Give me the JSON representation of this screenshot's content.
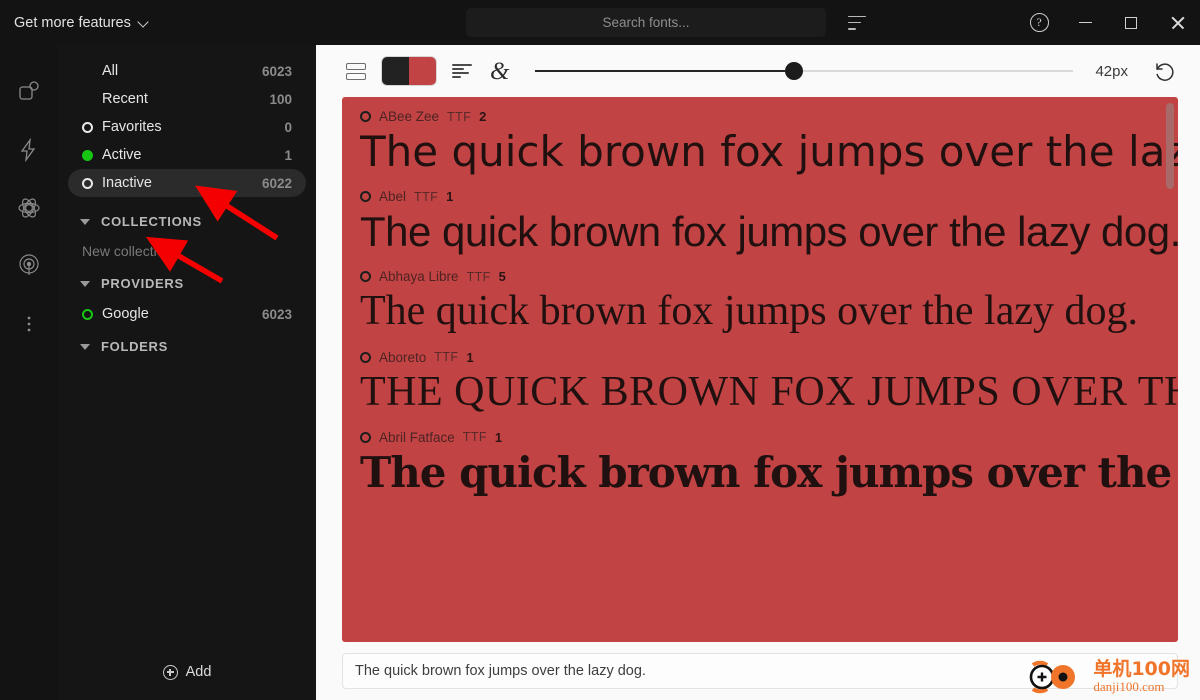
{
  "titlebar": {
    "features_label": "Get more features",
    "chevron_icon": "chevron-down-icon",
    "search_placeholder": "Search fonts...",
    "sort_icon": "sort-icon",
    "help_icon": "help-circle-icon",
    "minimize_icon": "minimize-icon",
    "maximize_icon": "maximize-icon",
    "close_icon": "close-icon"
  },
  "rail": {
    "items": [
      {
        "icon": "duplicate-shape-icon"
      },
      {
        "icon": "lightning-bolt-icon"
      },
      {
        "icon": "atom-icon"
      },
      {
        "icon": "broadcast-icon"
      },
      {
        "icon": "more-vertical-icon"
      }
    ]
  },
  "sidebar": {
    "nav": [
      {
        "label": "All",
        "count": "6023",
        "marker": "none",
        "selected": false
      },
      {
        "label": "Recent",
        "count": "100",
        "marker": "none",
        "selected": false
      },
      {
        "label": "Favorites",
        "count": "0",
        "marker": "ring",
        "selected": false
      },
      {
        "label": "Active",
        "count": "1",
        "marker": "green",
        "selected": false
      },
      {
        "label": "Inactive",
        "count": "6022",
        "marker": "ring",
        "selected": true
      }
    ],
    "collections": {
      "label": "COLLECTIONS",
      "new_collection": "New collection"
    },
    "providers": {
      "label": "PROVIDERS",
      "items": [
        {
          "name": "Google",
          "count": "6023"
        }
      ]
    },
    "folders": {
      "label": "FOLDERS"
    },
    "add_label": "Add",
    "add_icon": "plus-circle-icon"
  },
  "toolbar": {
    "view_rows_icon": "rows-view-icon",
    "color_swatch_icon": "color-swatch-icon",
    "swatch_fg": "#222222",
    "swatch_bg": "#c24343",
    "align_icon": "text-align-left-icon",
    "glyph_icon": "ampersand-icon",
    "size_label": "42px",
    "slider_percent": 48,
    "reset_icon": "reset-icon"
  },
  "preview": {
    "accent_color": "#c24343",
    "fonts": [
      {
        "name": "ABee Zee",
        "format": "TTF",
        "styles": "2",
        "sample": "The quick brown fox jumps over the lazy dog.",
        "class": "s-abee"
      },
      {
        "name": "Abel",
        "format": "TTF",
        "styles": "1",
        "sample": "The quick brown fox jumps over the lazy dog.",
        "class": "s-abel"
      },
      {
        "name": "Abhaya Libre",
        "format": "TTF",
        "styles": "5",
        "sample": "The quick brown fox jumps over the lazy dog.",
        "class": "s-abhaya"
      },
      {
        "name": "Aboreto",
        "format": "TTF",
        "styles": "1",
        "sample": "THE QUICK BROWN FOX JUMPS OVER THE LAZY DOG.",
        "class": "s-aboreto"
      },
      {
        "name": "Abril Fatface",
        "format": "TTF",
        "styles": "1",
        "sample": "The quick brown fox jumps over the lazy dog.",
        "class": "s-abril"
      }
    ]
  },
  "bottom": {
    "sample_text": "The quick brown fox jumps over the lazy dog."
  },
  "watermark": {
    "cn": "单机100网",
    "en": "danji100.com",
    "color": "#f0752a"
  }
}
